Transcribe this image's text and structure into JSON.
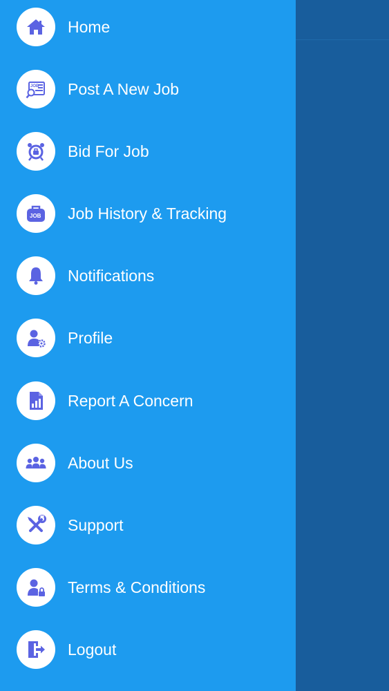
{
  "theme": {
    "drawer_color": "#1d9bef",
    "backdrop_color": "#185d9c",
    "icon_color": "#5b63e2",
    "icon_bg": "#ffffff",
    "text_color": "#ffffff"
  },
  "menu": {
    "items": [
      {
        "label": "Home",
        "icon": "home-icon"
      },
      {
        "label": "Post A New Job",
        "icon": "post-job-icon"
      },
      {
        "label": "Bid For Job",
        "icon": "bid-job-icon"
      },
      {
        "label": "Job History & Tracking",
        "icon": "job-briefcase-icon"
      },
      {
        "label": "Notifications",
        "icon": "bell-icon"
      },
      {
        "label": "Profile",
        "icon": "user-settings-icon"
      },
      {
        "label": "Report A Concern",
        "icon": "report-chart-icon"
      },
      {
        "label": "About Us",
        "icon": "group-icon"
      },
      {
        "label": "Support",
        "icon": "tools-icon"
      },
      {
        "label": "Terms & Conditions",
        "icon": "user-lock-icon"
      },
      {
        "label": "Logout",
        "icon": "logout-icon"
      }
    ]
  }
}
